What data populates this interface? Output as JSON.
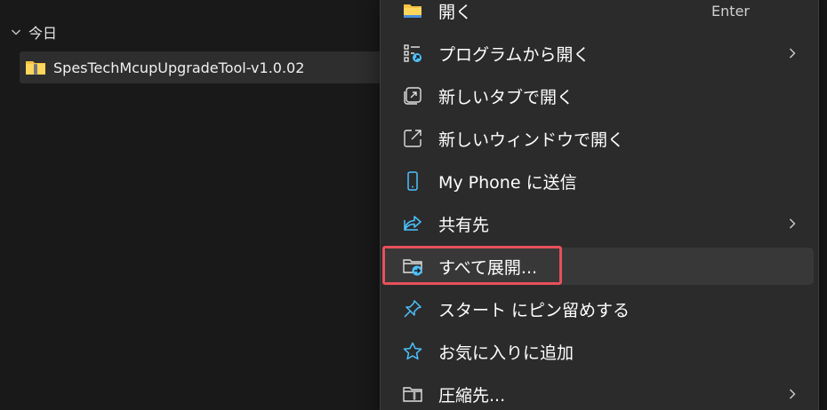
{
  "explorer": {
    "group_label": "今日",
    "file_name": "SpesTechMcupUpgradeTool-v1.0.02"
  },
  "menu": {
    "items": [
      {
        "label": "開く",
        "icon": "folder-icon",
        "shortcut": "Enter"
      },
      {
        "label": "プログラムから開く",
        "icon": "open-with-icon",
        "submenu": true
      },
      {
        "label": "新しいタブで開く",
        "icon": "new-tab-icon"
      },
      {
        "label": "新しいウィンドウで開く",
        "icon": "new-window-icon"
      },
      {
        "label": "My Phone に送信",
        "icon": "phone-icon"
      },
      {
        "label": "共有先",
        "icon": "share-icon",
        "submenu": true
      },
      {
        "label": "すべて展開...",
        "icon": "extract-all-icon",
        "highlighted": true
      },
      {
        "label": "スタート にピン留めする",
        "icon": "pin-icon"
      },
      {
        "label": "お気に入りに追加",
        "icon": "star-icon"
      },
      {
        "label": "圧縮先...",
        "icon": "compress-icon",
        "submenu": true
      }
    ]
  },
  "colors": {
    "background": "#191919",
    "menu_background": "#2b2b2b",
    "accent_blue": "#4cc2ff",
    "highlight_red": "#e8505b"
  }
}
